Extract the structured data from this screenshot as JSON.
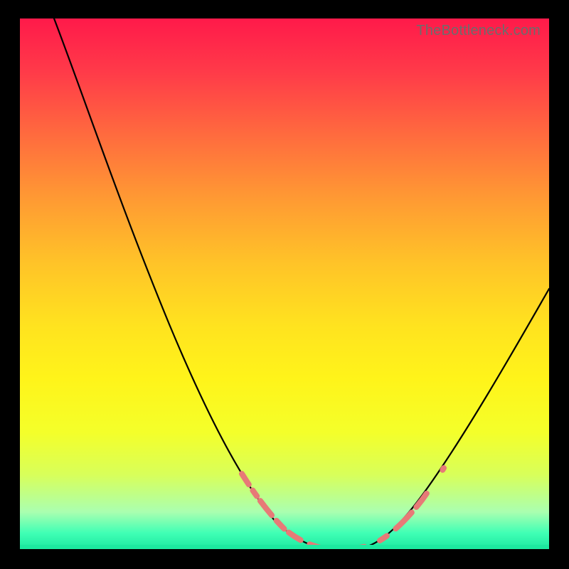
{
  "watermark": {
    "text": "TheBottleneck.com"
  },
  "colors": {
    "page_bg": "#000000",
    "gradient_top": "#ff1a4a",
    "gradient_bottom": "#1de9a0",
    "curve_stroke": "#000000",
    "highlight_stroke": "#e77a77",
    "watermark_text": "#6c6c6c"
  },
  "chart_data": {
    "type": "line",
    "title": "",
    "xlabel": "",
    "ylabel": "",
    "xlim": [
      0,
      100
    ],
    "ylim": [
      0,
      100
    ],
    "grid": false,
    "legend": false,
    "series": [
      {
        "name": "bottleneck-curve",
        "x": [
          0,
          5,
          10,
          15,
          20,
          25,
          30,
          35,
          40,
          45,
          50,
          52,
          55,
          58,
          60,
          62,
          65,
          68,
          72,
          76,
          80,
          85,
          90,
          95,
          100
        ],
        "y": [
          100,
          91,
          81,
          72,
          63,
          54,
          45,
          36,
          27,
          18,
          10,
          6,
          3,
          1,
          0,
          0,
          1,
          3,
          7,
          12,
          18,
          26,
          35,
          44,
          53
        ]
      }
    ],
    "highlight_region": {
      "series": "bottleneck-curve",
      "x_range": [
        45,
        76
      ],
      "style": "dashed"
    },
    "annotations": []
  }
}
